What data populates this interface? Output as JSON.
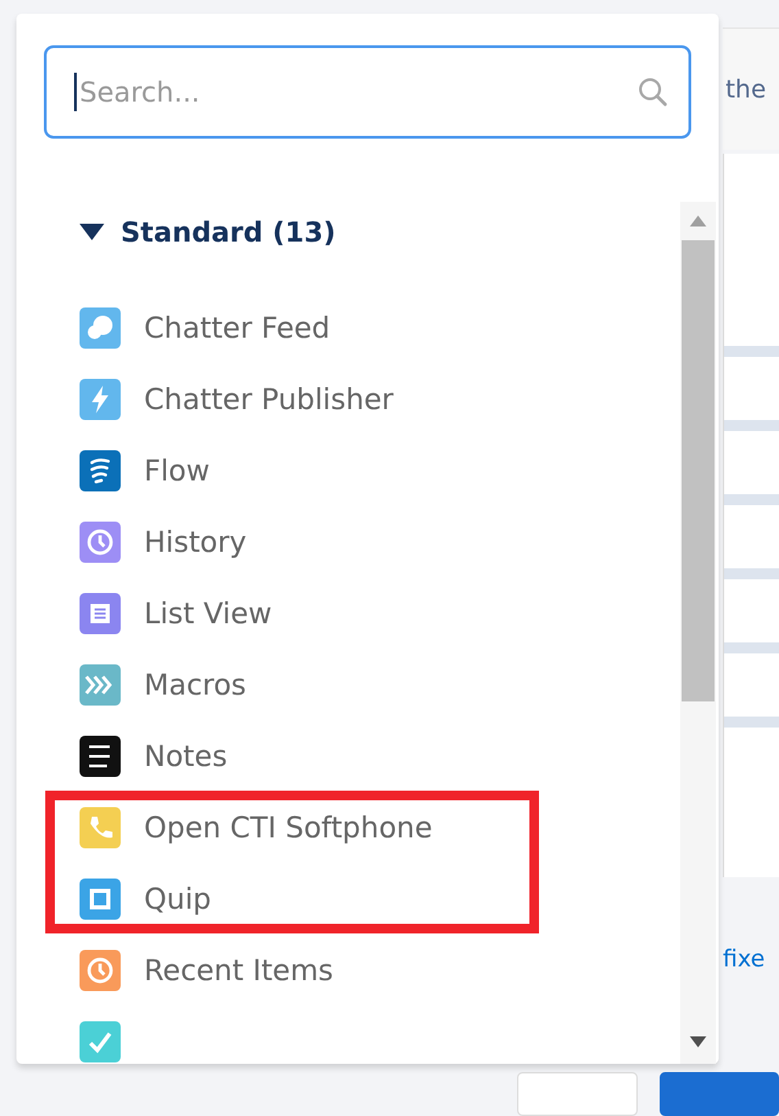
{
  "background": {
    "heading_fragment": "the",
    "link_fragment": "fixe"
  },
  "search": {
    "placeholder": "Search..."
  },
  "group": {
    "label": "Standard (13)",
    "expanded": true
  },
  "items": [
    {
      "label": "Chatter Feed",
      "kind": "chat",
      "color": "#62b7ed"
    },
    {
      "label": "Chatter Publisher",
      "kind": "bolt",
      "color": "#62b7ed"
    },
    {
      "label": "Flow",
      "kind": "waves",
      "color": "#0b70b8"
    },
    {
      "label": "History",
      "kind": "clock",
      "color": "#9d8ef5"
    },
    {
      "label": "List View",
      "kind": "list",
      "color": "#8b85f0"
    },
    {
      "label": "Macros",
      "kind": "chevrons",
      "color": "#6ab8c8"
    },
    {
      "label": "Notes",
      "kind": "notes",
      "color": "#111111"
    },
    {
      "label": "Open CTI Softphone",
      "kind": "phone",
      "color": "#f4cf52"
    },
    {
      "label": "Quip",
      "kind": "square",
      "color": "#3ba4e6"
    },
    {
      "label": "Recent Items",
      "kind": "clock",
      "color": "#f99a5a"
    },
    {
      "kind": "check",
      "color": "#4bd0d6"
    }
  ]
}
